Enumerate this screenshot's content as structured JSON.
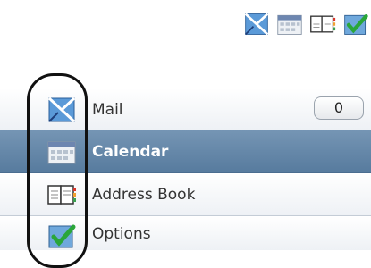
{
  "toolbar": {
    "icons": [
      "mail-icon",
      "calendar-icon",
      "address-book-icon",
      "options-icon"
    ]
  },
  "nav": {
    "items": [
      {
        "label": "Mail",
        "icon": "mail-icon",
        "count": "0",
        "selected": false
      },
      {
        "label": "Calendar",
        "icon": "calendar-icon",
        "selected": true
      },
      {
        "label": "Address Book",
        "icon": "address-book-icon",
        "selected": false
      },
      {
        "label": "Options",
        "icon": "options-icon",
        "selected": false
      }
    ]
  },
  "colors": {
    "selected_row": "#577b9e",
    "row_border": "#c4ccd6",
    "highlight_ring": "#111111"
  }
}
